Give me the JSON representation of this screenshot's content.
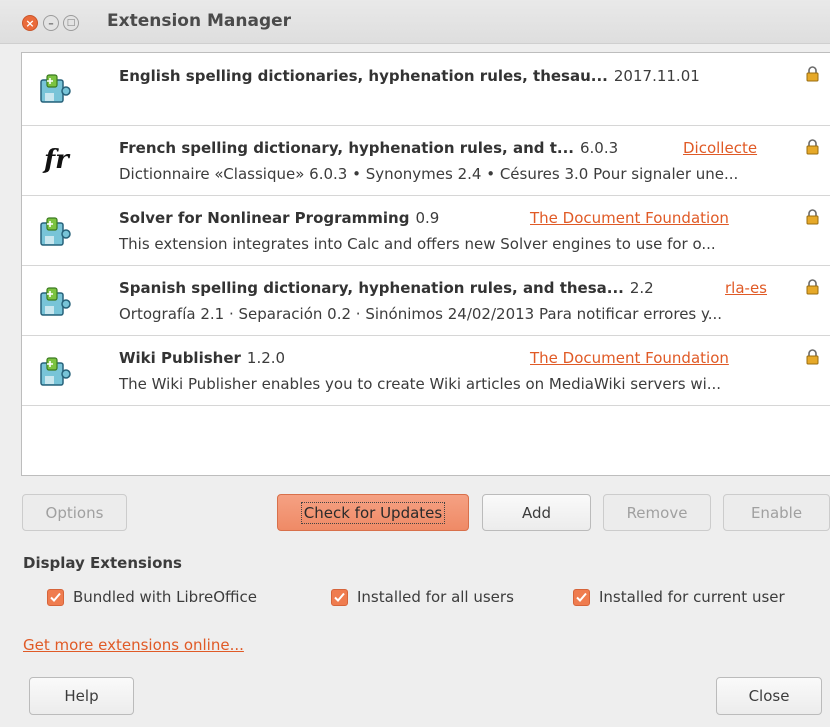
{
  "window": {
    "title": "Extension Manager"
  },
  "extensions": [
    {
      "name": "English spelling dictionaries, hyphenation rules, thesau...",
      "version": "2017.11.01",
      "publisher": "",
      "description": "",
      "icon": "puzzle-icon"
    },
    {
      "name": "French spelling dictionary, hyphenation rules, and t...",
      "version": "6.0.3",
      "publisher": "Dicollecte",
      "description": "Dictionnaire «Classique» 6.0.3 • Synonymes 2.4 • Césures 3.0  Pour signaler une...",
      "icon": "fr-icon"
    },
    {
      "name": "Solver for Nonlinear Programming",
      "version": "0.9",
      "publisher": "The Document Foundation",
      "description": "This extension integrates into Calc and offers new Solver engines to use for o...",
      "icon": "puzzle-icon"
    },
    {
      "name": "Spanish spelling dictionary, hyphenation rules, and thesa...",
      "version": "2.2",
      "publisher": "rla-es",
      "description": "Ortografía 2.1 · Separación 0.2 · Sinónimos 24/02/2013  Para notificar errores y...",
      "icon": "puzzle-icon"
    },
    {
      "name": "Wiki Publisher",
      "version": "1.2.0",
      "publisher": "The Document Foundation",
      "description": "The Wiki Publisher enables you to create Wiki articles on MediaWiki servers wi...",
      "icon": "puzzle-icon"
    }
  ],
  "actions": {
    "options": "Options",
    "check_updates": "Check for Updates",
    "add": "Add",
    "remove": "Remove",
    "enable": "Enable"
  },
  "display": {
    "label": "Display Extensions",
    "bundled": "Bundled with LibreOffice",
    "all_users": "Installed for all users",
    "current_user": "Installed for current user"
  },
  "links": {
    "more": "Get more extensions online..."
  },
  "footer": {
    "help": "Help",
    "close": "Close"
  },
  "colors": {
    "accent": "#ef7c4f",
    "link": "#e05a26"
  }
}
